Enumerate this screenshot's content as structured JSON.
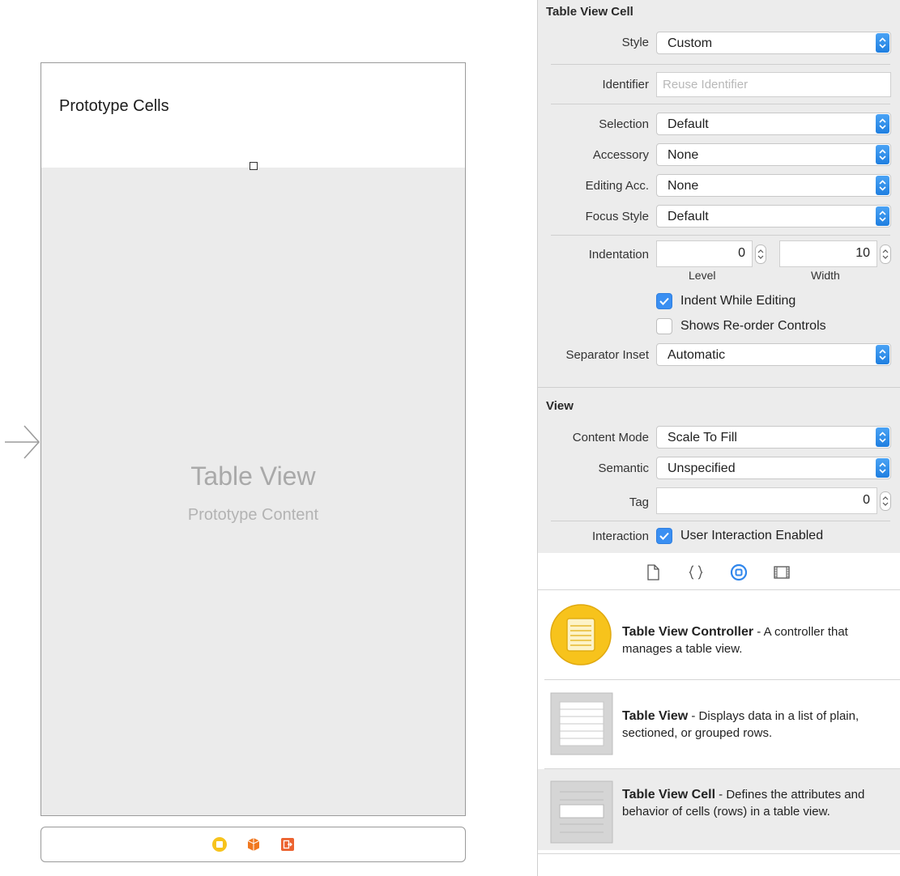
{
  "canvas": {
    "header_title": "Prototype Cells",
    "table_view_title": "Table View",
    "table_view_subtitle": "Prototype Content"
  },
  "table_view_cell_section": {
    "title": "Table View Cell",
    "style": {
      "label": "Style",
      "value": "Custom"
    },
    "identifier": {
      "label": "Identifier",
      "placeholder": "Reuse Identifier"
    },
    "selection": {
      "label": "Selection",
      "value": "Default"
    },
    "accessory": {
      "label": "Accessory",
      "value": "None"
    },
    "editing_acc": {
      "label": "Editing Acc.",
      "value": "None"
    },
    "focus_style": {
      "label": "Focus Style",
      "value": "Default"
    },
    "indentation": {
      "label": "Indentation",
      "level_value": "0",
      "level_label": "Level",
      "width_value": "10",
      "width_label": "Width"
    },
    "indent_while_editing": {
      "label": "Indent While Editing",
      "checked": true
    },
    "shows_reorder": {
      "label": "Shows Re-order Controls",
      "checked": false
    },
    "separator_inset": {
      "label": "Separator Inset",
      "value": "Automatic"
    }
  },
  "view_section": {
    "title": "View",
    "content_mode": {
      "label": "Content Mode",
      "value": "Scale To Fill"
    },
    "semantic": {
      "label": "Semantic",
      "value": "Unspecified"
    },
    "tag": {
      "label": "Tag",
      "value": "0"
    },
    "interaction": {
      "label": "Interaction",
      "checkbox_label": "User Interaction Enabled",
      "checked": true
    }
  },
  "library": {
    "tabs": [
      "file-template-icon",
      "code-snippet-icon",
      "object-library-icon",
      "media-library-icon"
    ],
    "active_tab": "object-library-icon",
    "items": [
      {
        "name": "Table View Controller",
        "desc": " - A controller that manages a table view.",
        "icon": "table-view-controller-icon"
      },
      {
        "name": "Table View",
        "desc": " - Displays data in a list of plain, sectioned, or grouped rows.",
        "icon": "table-view-icon"
      },
      {
        "name": "Table View Cell",
        "desc": " - Defines the attributes and behavior of cells (rows) in a table view.",
        "icon": "table-view-cell-icon"
      }
    ]
  },
  "colors": {
    "accent": "#3a8ff2",
    "controller_yellow": "#f7c31c",
    "first_responder_orange": "#f0771f",
    "exit_orange": "#ec6330"
  }
}
